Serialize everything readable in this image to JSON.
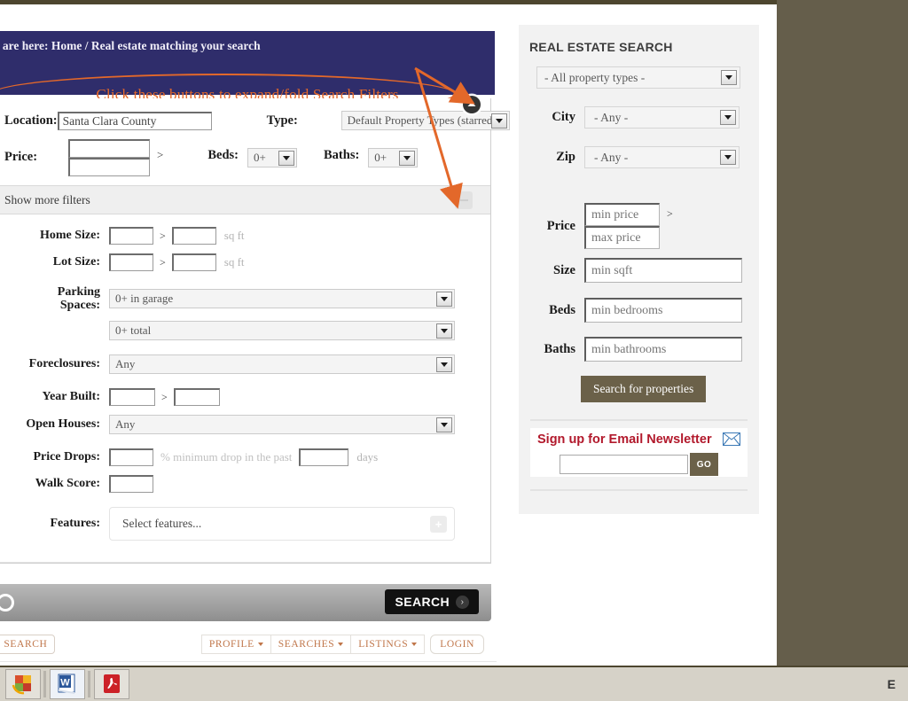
{
  "desktop": {
    "background_color": "#655e4b",
    "taskbar": {
      "items": [
        {
          "name": "photo-app-icon",
          "glyph": "■"
        },
        {
          "name": "word-icon",
          "glyph": "W"
        },
        {
          "name": "acrobat-icon",
          "glyph": "⮟"
        }
      ],
      "tray_text": "E"
    }
  },
  "header": {
    "breadcrumb_prefix": "u are here:",
    "breadcrumb_home": "Home",
    "breadcrumb_sep": "/",
    "breadcrumb_current": "Real estate matching your search",
    "band_color": "#2f2d6b"
  },
  "annotation": {
    "text": "Click these buttons to expand/fold Search Filters",
    "color": "#e3682a"
  },
  "search_form": {
    "location": {
      "label": "Location:",
      "value": "Santa Clara County",
      "placeholder": ""
    },
    "type": {
      "label": "Type:",
      "value": "Default Property Types (starred)"
    },
    "price": {
      "label": "Price:",
      "min_value": "",
      "max_value": "",
      "separator": ">"
    },
    "beds": {
      "label": "Beds:",
      "value": "0+"
    },
    "baths": {
      "label": "Baths:",
      "value": "0+"
    },
    "more_filters_label": "Show more filters",
    "collapse_button": "minus-button",
    "expand_button": "up-chevron-button"
  },
  "advanced_filters": {
    "home_size": {
      "label": "Home Size:",
      "min": "",
      "max": "",
      "unit": "sq ft",
      "sep": ">"
    },
    "lot_size": {
      "label": "Lot Size:",
      "min": "",
      "max": "",
      "unit": "sq ft",
      "sep": ">"
    },
    "parking": {
      "label_line1": "Parking",
      "label_line2": "Spaces:",
      "garage_value": "0+ in garage",
      "total_value": "0+ total"
    },
    "foreclosures": {
      "label": "Foreclosures:",
      "value": "Any"
    },
    "year_built": {
      "label": "Year Built:",
      "min": "",
      "max": "",
      "sep": ">"
    },
    "open_houses": {
      "label": "Open Houses:",
      "value": "Any"
    },
    "price_drops": {
      "label": "Price Drops:",
      "percent": "",
      "mid_text": "% minimum drop in the past",
      "days": "",
      "days_text": "days"
    },
    "walk_score": {
      "label": "Walk Score:",
      "value": ""
    },
    "features": {
      "label": "Features:",
      "placeholder": "Select features...",
      "add_button": "+"
    }
  },
  "search_bar": {
    "button_label": "SEARCH",
    "button_chevron": "›"
  },
  "footer": {
    "save_search": "AVE SEARCH",
    "menus": [
      {
        "label": "PROFILE"
      },
      {
        "label": "SEARCHES"
      },
      {
        "label": "LISTINGS"
      }
    ],
    "login": "LOGIN"
  },
  "sidebar": {
    "title": "REAL ESTATE SEARCH",
    "property_types": "- All property types -",
    "city": {
      "label": "City",
      "value": "- Any -"
    },
    "zip": {
      "label": "Zip",
      "value": "- Any -"
    },
    "price": {
      "label": "Price",
      "min_placeholder": "min price",
      "max_placeholder": "max price",
      "sep": ">"
    },
    "size": {
      "label": "Size",
      "placeholder": "min sqft"
    },
    "beds": {
      "label": "Beds",
      "placeholder": "min bedrooms"
    },
    "baths": {
      "label": "Baths",
      "placeholder": "min bathrooms"
    },
    "search_button": "Search for properties",
    "newsletter": {
      "title": "Sign up for Email Newsletter",
      "input_value": "",
      "go_label": "GO",
      "icon": "envelope-icon"
    },
    "accent_color": "#6b6149",
    "newsletter_color": "#b2192c"
  }
}
